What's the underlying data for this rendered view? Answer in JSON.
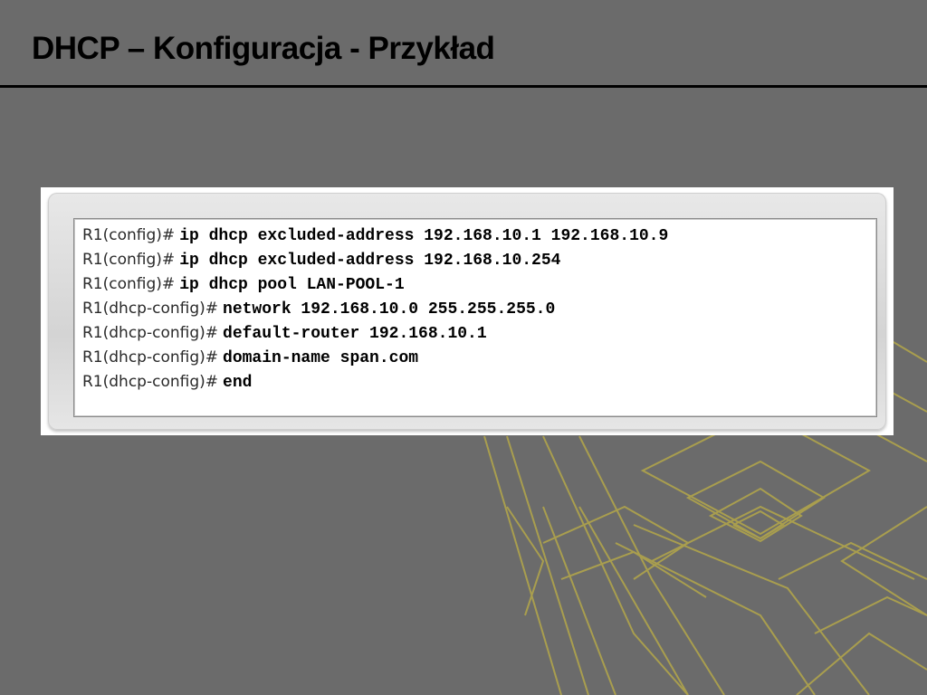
{
  "slide": {
    "title": "DHCP – Konfiguracja - Przykład"
  },
  "cli": {
    "lines": [
      {
        "prompt": "R1(config)#",
        "command": "ip dhcp excluded-address 192.168.10.1 192.168.10.9"
      },
      {
        "prompt": "R1(config)#",
        "command": "ip dhcp excluded-address 192.168.10.254"
      },
      {
        "prompt": "R1(config)#",
        "command": "ip dhcp pool LAN-POOL-1"
      },
      {
        "prompt": "R1(dhcp-config)#",
        "command": "network 192.168.10.0 255.255.255.0"
      },
      {
        "prompt": "R1(dhcp-config)#",
        "command": "default-router 192.168.10.1"
      },
      {
        "prompt": "R1(dhcp-config)#",
        "command": "domain-name span.com"
      },
      {
        "prompt": "R1(dhcp-config)#",
        "command": "end"
      }
    ]
  },
  "colors": {
    "background": "#6b6b6b",
    "decoration": "#b4a84a",
    "title": "#000000"
  }
}
